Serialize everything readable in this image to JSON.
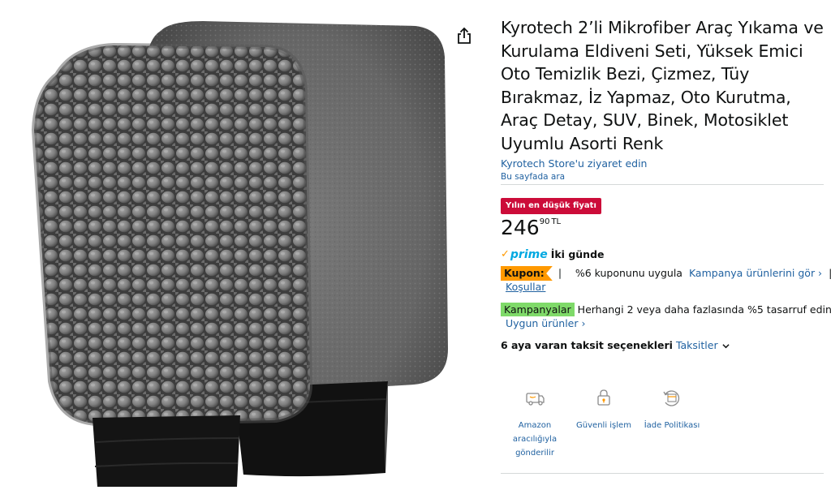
{
  "product": {
    "title": "Kyrotech 2’li Mikrofiber Araç Yıkama ve Kurulama Eldiveni Seti, Yüksek Emici Oto Temizlik Bezi, Çizmez, Tüy Bırakmaz, İz Yapmaz, Oto Kurutma, Araç Detay, SUV, Binek, Motosiklet Uyumlu Asorti Renk",
    "store_link": "Kyrotech Store'u ziyaret edin",
    "search_page": "Bu sayfada ara",
    "image_icon": "product-image-gloves",
    "share_icon": "share-icon"
  },
  "deal": {
    "badge": "Yılın en düşük fiyatı",
    "badge_color": "#cc0c39"
  },
  "price": {
    "whole": "246",
    "fraction": "90",
    "currency": "TL"
  },
  "prime": {
    "check": "✓",
    "word": "prime",
    "delivery": "İki günde"
  },
  "coupon": {
    "badge": "Kupon:",
    "text": "%6 kuponunu uygula",
    "link": "Kampanya ürünlerini gör ›",
    "pipe": "|",
    "terms": "Koşullar",
    "badge_color": "#ff9900"
  },
  "campaign": {
    "badge": "Kampanyalar",
    "text": "Herhangi 2 veya daha fazlasında %5 tasarruf edin.",
    "eligible": "Uygun ürünler ›",
    "badge_color": "#7fda69"
  },
  "installment": {
    "label": "6 aya varan taksit seçenekleri",
    "link": "Taksitler"
  },
  "features": [
    {
      "icon": "truck-box-icon",
      "label": "Amazon aracılığıyla gönderilir"
    },
    {
      "icon": "lock-icon",
      "label": "Güvenli işlem"
    },
    {
      "icon": "return-box-icon",
      "label": "İade Politikası"
    }
  ],
  "colors": {
    "link": "#2162a1",
    "text": "#0f1111",
    "divider": "#d5d9d9"
  }
}
